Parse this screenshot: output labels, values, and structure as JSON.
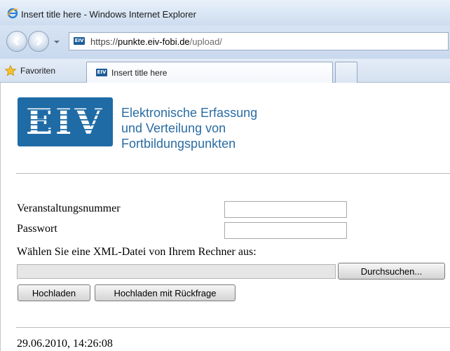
{
  "window": {
    "title": "Insert title here - Windows Internet Explorer"
  },
  "address_bar": {
    "site_icon": "EIV",
    "url_scheme": "https://",
    "url_host": "punkte.eiv-fobi.de",
    "url_path": "/upload/"
  },
  "favorites_bar": {
    "favorites_label": "Favoriten",
    "tab_icon": "EIV",
    "tab_title": "Insert title here"
  },
  "page": {
    "logo_text": "EIV",
    "org_name_lines": [
      "Elektronische Erfassung",
      "und Verteilung von",
      "Fortbildungspunkten"
    ],
    "brand_color": "#1f6ba6",
    "form": {
      "event_number_label": "Veranstaltungsnummer",
      "event_number_value": "",
      "password_label": "Passwort",
      "password_value": "",
      "file_prompt": "Wählen Sie eine XML-Datei von Ihrem Rechner aus:",
      "file_value": "",
      "browse_button": "Durchsuchen...",
      "upload_button": "Hochladen",
      "upload_confirm_button": "Hochladen mit Rückfrage"
    },
    "timestamp": "29.06.2010, 14:26:08"
  }
}
